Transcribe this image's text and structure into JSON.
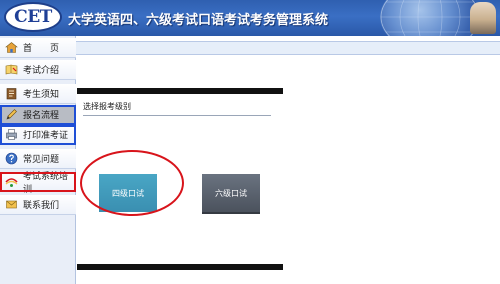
{
  "header": {
    "logo_text": "CET",
    "title": "大学英语四、六级考试口语考试考务管理系统"
  },
  "sidebar": {
    "items": [
      {
        "label": "首　　页",
        "icon": "home-icon"
      },
      {
        "label": "考试介绍",
        "icon": "book-icon"
      },
      {
        "label": "考生须知",
        "icon": "notice-icon"
      },
      {
        "label": "报名流程",
        "icon": "pencil-icon"
      },
      {
        "label": "打印准考证",
        "icon": "printer-icon"
      },
      {
        "label": "常见问题",
        "icon": "question-icon"
      },
      {
        "label": "考试系统培训",
        "icon": "training-icon"
      },
      {
        "label": "联系我们",
        "icon": "contact-icon"
      }
    ]
  },
  "main": {
    "panel_title": "选择报考级别",
    "buttons": {
      "cet4": "四级口试",
      "cet6": "六级口试"
    }
  },
  "colors": {
    "header_blue": "#2f5fb0",
    "cet4_button": "#3a8fb1",
    "cet6_button": "#4b525d",
    "annotation_red": "#d8141b",
    "annotation_blue": "#1f4fd6"
  }
}
